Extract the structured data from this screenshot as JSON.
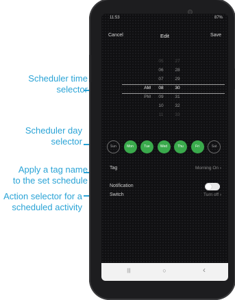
{
  "callouts": {
    "time_selector": [
      "Scheduler time",
      "selector"
    ],
    "day_selector": [
      "Scheduler day",
      "selector"
    ],
    "tag": [
      "Apply a tag name",
      "to the set schedule"
    ],
    "action": [
      "Action selector for a",
      "scheduled activity"
    ]
  },
  "status_bar": {
    "time": "11:53",
    "right": "87%"
  },
  "header": {
    "cancel": "Cancel",
    "title": "Edit",
    "save": "Save"
  },
  "picker": {
    "rows": [
      {
        "ampm": "",
        "hour": "05",
        "min": "27",
        "state": "fade"
      },
      {
        "ampm": "",
        "hour": "06",
        "min": "28",
        "state": "dim"
      },
      {
        "ampm": "",
        "hour": "07",
        "min": "29",
        "state": "dim"
      },
      {
        "ampm": "AM",
        "hour": "08",
        "min": "30",
        "state": "selected"
      },
      {
        "ampm": "PM",
        "hour": "09",
        "min": "31",
        "state": "dim"
      },
      {
        "ampm": "",
        "hour": "10",
        "min": "32",
        "state": "dim"
      },
      {
        "ampm": "",
        "hour": "11",
        "min": "33",
        "state": "fade"
      }
    ]
  },
  "days": [
    {
      "label": "Sun",
      "on": false
    },
    {
      "label": "Mon",
      "on": true
    },
    {
      "label": "Tue",
      "on": true
    },
    {
      "label": "Wed",
      "on": true
    },
    {
      "label": "Thu",
      "on": true
    },
    {
      "label": "Fri",
      "on": true
    },
    {
      "label": "Sat",
      "on": false
    }
  ],
  "tag_row": {
    "label": "Tag",
    "value": "Morning On"
  },
  "notification_row": {
    "label": "Notification",
    "enabled": false
  },
  "switch_row": {
    "label": "Switch",
    "value": "Turn off"
  },
  "navbar": {
    "recent": "|||",
    "home": "○",
    "back": "‹"
  }
}
